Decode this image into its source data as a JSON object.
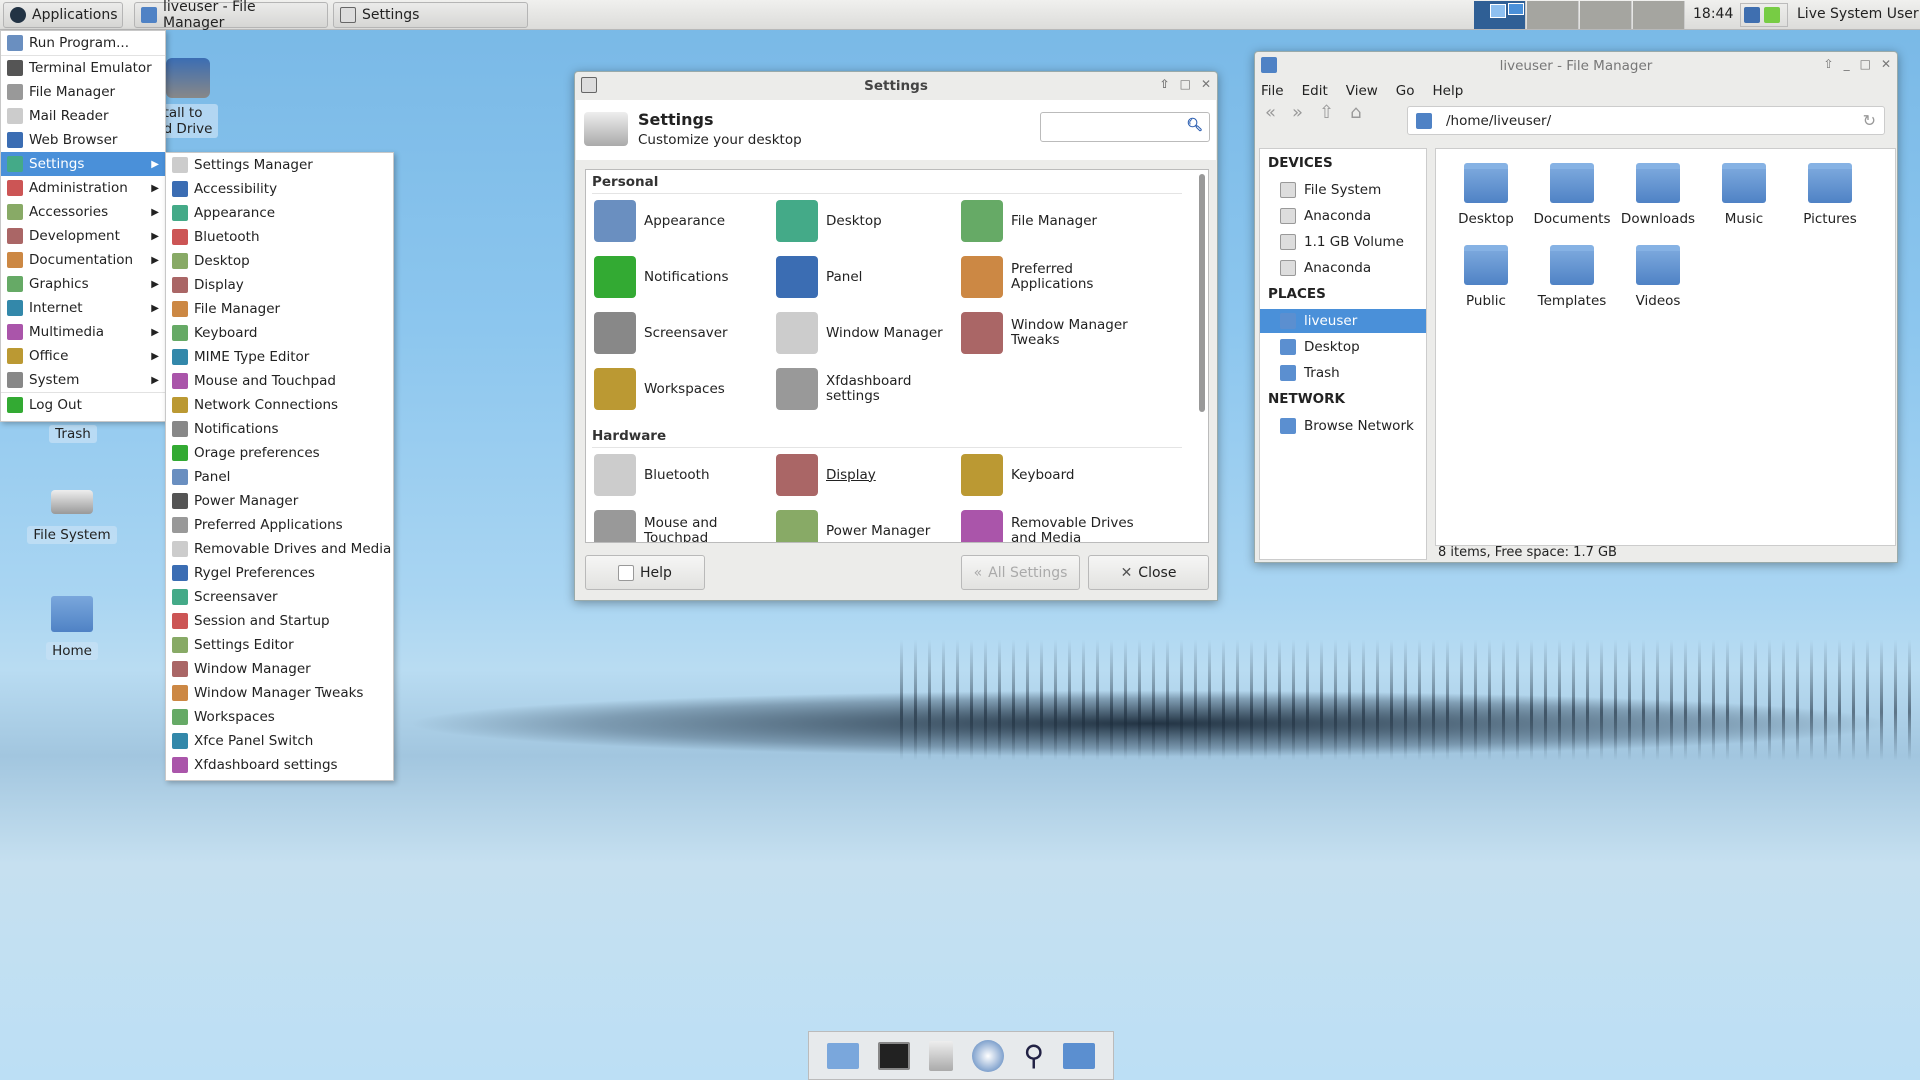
{
  "panel": {
    "applications": "Applications",
    "tasks": [
      {
        "label": "liveuser - File Manager",
        "icon": "home-folder-icon"
      },
      {
        "label": "Settings",
        "icon": "settings-icon"
      }
    ],
    "clock": "18:44",
    "user": "Live System User"
  },
  "app_menu": {
    "items": [
      "Run Program...",
      "Terminal Emulator",
      "File Manager",
      "Mail Reader",
      "Web Browser",
      "Settings",
      "Administration",
      "Accessories",
      "Development",
      "Documentation",
      "Graphics",
      "Internet",
      "Multimedia",
      "Office",
      "System",
      "Log Out"
    ]
  },
  "settings_submenu": {
    "items": [
      "Settings Manager",
      "Accessibility",
      "Appearance",
      "Bluetooth",
      "Desktop",
      "Display",
      "File Manager",
      "Keyboard",
      "MIME Type Editor",
      "Mouse and Touchpad",
      "Network Connections",
      "Notifications",
      "Orage preferences",
      "Panel",
      "Power Manager",
      "Preferred Applications",
      "Removable Drives and Media",
      "Rygel Preferences",
      "Screensaver",
      "Session and Startup",
      "Settings Editor",
      "Window Manager",
      "Window Manager Tweaks",
      "Workspaces",
      "Xfce Panel Switch",
      "Xfdashboard settings"
    ]
  },
  "desktop": {
    "install": "tall to\nd Drive",
    "icons": [
      "Trash",
      "File System",
      "Home"
    ]
  },
  "settings_window": {
    "title": "Settings",
    "heading": "Settings",
    "subtitle": "Customize your desktop",
    "search_placeholder": "",
    "sections": [
      {
        "name": "Personal",
        "items": [
          "Appearance",
          "Desktop",
          "File Manager",
          "Notifications",
          "Panel",
          "Preferred Applications",
          "Screensaver",
          "Window Manager",
          "Window Manager Tweaks",
          "Workspaces",
          "Xfdashboard settings"
        ]
      },
      {
        "name": "Hardware",
        "items": [
          "Bluetooth",
          "Display",
          "Keyboard",
          "Mouse and Touchpad",
          "Power Manager",
          "Removable Drives and Media"
        ]
      }
    ],
    "help": "Help",
    "all_settings": "All Settings",
    "close": "Close"
  },
  "file_manager": {
    "title": "liveuser - File Manager",
    "menu": [
      "File",
      "Edit",
      "View",
      "Go",
      "Help"
    ],
    "path": "/home/liveuser/",
    "devices_header": "DEVICES",
    "devices": [
      "File System",
      "Anaconda",
      "1.1 GB Volume",
      "Anaconda"
    ],
    "places_header": "PLACES",
    "places": [
      "liveuser",
      "Desktop",
      "Trash"
    ],
    "network_header": "NETWORK",
    "network": [
      "Browse Network"
    ],
    "folders": [
      "Desktop",
      "Documents",
      "Downloads",
      "Music",
      "Pictures",
      "Public",
      "Templates",
      "Videos"
    ],
    "status": "8 items, Free space: 1.7 GB"
  },
  "colors": {
    "accent": "#4a90d9"
  }
}
